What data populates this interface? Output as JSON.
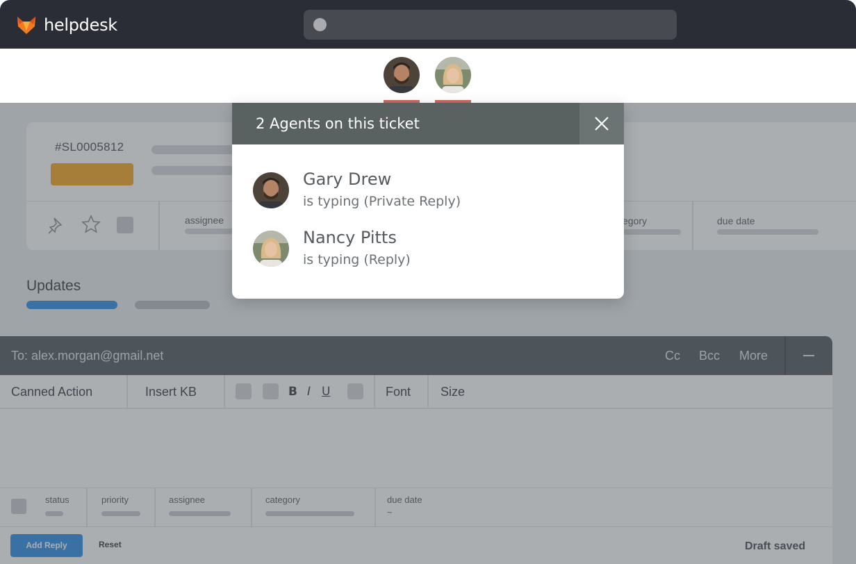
{
  "app": {
    "brand": "helpdesk",
    "accent": "#2f8fe8",
    "badge_color": "#f5a623",
    "logo_colors": [
      "#f27a20",
      "#fbb03b"
    ]
  },
  "agents_strip": [
    {
      "name": "Gary Drew",
      "icon": "avatar-photo"
    },
    {
      "name": "Nancy Pitts",
      "icon": "avatar-photo"
    }
  ],
  "ticket": {
    "id": "#SL0005812",
    "meta_labels": {
      "assignee": "assignee",
      "category": "egory",
      "due_date": "due date"
    }
  },
  "updates": {
    "title": "Updates"
  },
  "composer": {
    "to": "To: alex.morgan@gmail.net",
    "cc": "Cc",
    "bcc": "Bcc",
    "more": "More",
    "toolbar": {
      "canned_action": "Canned Action",
      "insert_kb": "Insert KB",
      "bold": "B",
      "italic": "I",
      "underline": "U",
      "font": "Font",
      "size": "Size"
    },
    "footer_meta": {
      "status": "status",
      "priority": "priority",
      "assignee": "assignee",
      "category": "category",
      "due_date": "due date",
      "due_date_value": "~"
    },
    "add_reply": "Add Reply",
    "reset": "Reset",
    "draft_status": "Draft saved"
  },
  "modal": {
    "title": "2 Agents on this ticket",
    "close_icon": "close-icon",
    "agents": [
      {
        "name": "Gary Drew",
        "status": "is typing (Private Reply)"
      },
      {
        "name": "Nancy Pitts",
        "status": "is typing (Reply)"
      }
    ]
  }
}
